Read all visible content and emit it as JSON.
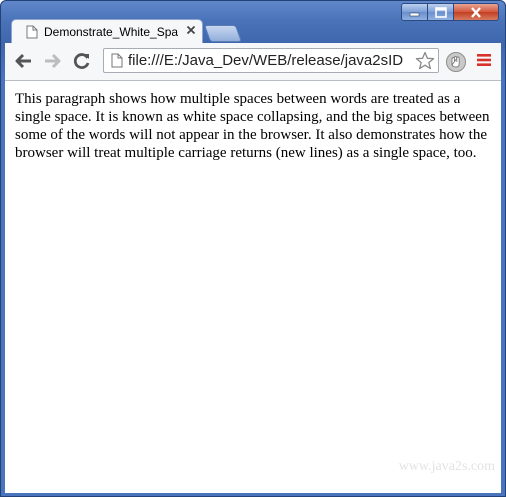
{
  "window": {
    "tab": {
      "title": "Demonstrate_White_Space",
      "favicon": "page-icon",
      "close_icon": "close-icon"
    }
  },
  "toolbar": {
    "back_icon": "back-arrow-icon",
    "forward_icon": "forward-arrow-icon",
    "reload_icon": "reload-icon",
    "url": "file:///E:/Java_Dev/WEB/release/java2sID",
    "bookmark_icon": "star-icon",
    "extension_icon": "extension-icon",
    "menu_icon": "menu-icon",
    "menu_color": "#d9302b"
  },
  "content": {
    "paragraph": "This paragraph shows how multiple spaces between words are treated as a single space. It is known as white space collapsing, and the big spaces between some of the words will not appear in the browser. It also demonstrates how the browser will treat multiple carriage returns (new lines) as a single space, too.",
    "watermark": "www.java2s.com"
  }
}
